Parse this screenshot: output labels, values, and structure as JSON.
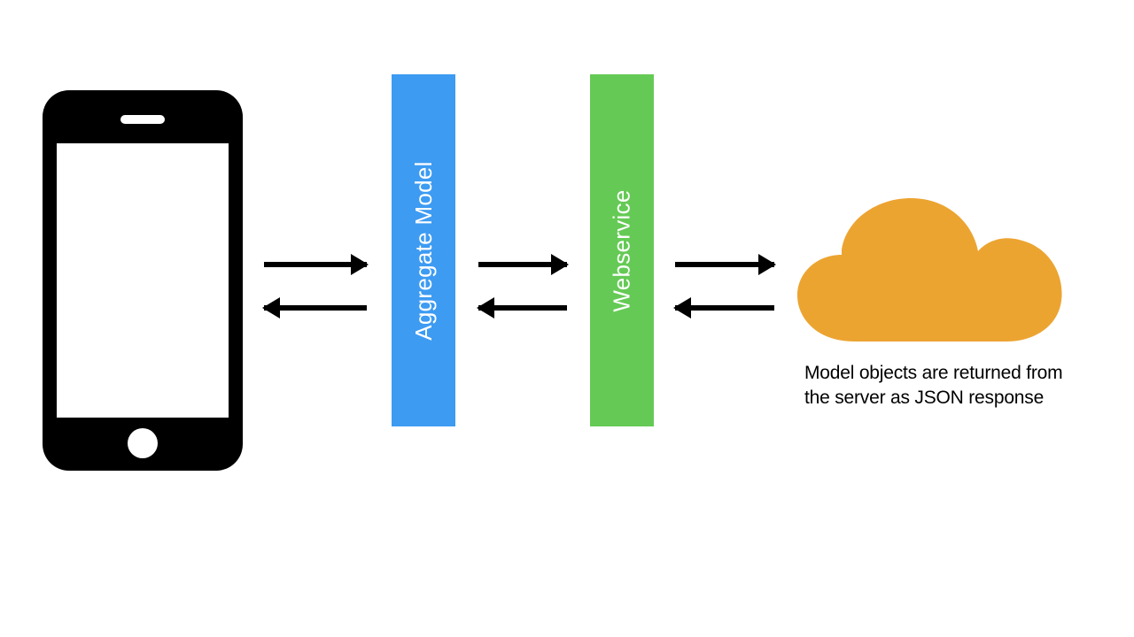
{
  "layers": {
    "aggregate": "Aggregate Model",
    "webservice": "Webservice"
  },
  "caption": "Model objects are returned from the server as JSON response",
  "colors": {
    "aggregate": "#3d9bf2",
    "webservice": "#65ca55",
    "cloud": "#eca431",
    "arrow": "#000000"
  },
  "flow": [
    {
      "from": "phone",
      "to": "aggregate-model",
      "bidirectional": true
    },
    {
      "from": "aggregate-model",
      "to": "webservice",
      "bidirectional": true
    },
    {
      "from": "webservice",
      "to": "cloud-server",
      "bidirectional": true
    }
  ]
}
